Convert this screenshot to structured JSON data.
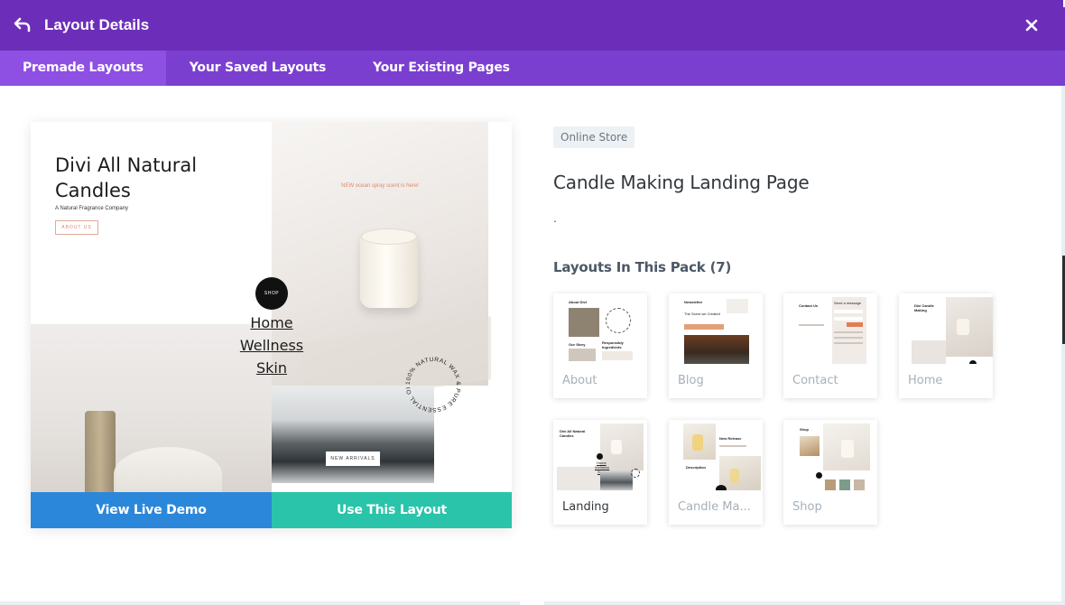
{
  "header": {
    "title": "Layout Details",
    "back_icon": "undo-arrow-icon",
    "close_icon": "close-icon",
    "color": "#6c2eb9"
  },
  "tabs": [
    {
      "label": "Premade Layouts",
      "active": true
    },
    {
      "label": "Your Saved Layouts",
      "active": false
    },
    {
      "label": "Your Existing Pages",
      "active": false
    }
  ],
  "preview": {
    "title": "Divi All Natural Candles",
    "subtitle": "A Natural Fragrance Company",
    "about_button": "ABOUT US",
    "announcement": "NEW ocean spray scent is here!",
    "shop_button": "SHOP",
    "links": [
      "Home",
      "Wellness",
      "Skin"
    ],
    "badge_text": "100% NATURAL WAX & PURE ESSENTIAL OILS •",
    "arrivals_button": "NEW ARRIVALS"
  },
  "actions": {
    "demo_label": "View Live Demo",
    "use_label": "Use This Layout",
    "demo_color": "#2b87da",
    "use_color": "#29c4a9"
  },
  "details": {
    "category": "Online Store",
    "title": "Candle Making Landing Page",
    "description": ".",
    "pack_heading": "Layouts In This Pack (7)"
  },
  "pack": [
    {
      "label": "About",
      "active": false,
      "thumb_text": [
        "About Divi",
        "Our Story",
        "Responsibly Ingredients"
      ]
    },
    {
      "label": "Blog",
      "active": false,
      "thumb_text": [
        "Newsletter",
        "The Scent we Created"
      ]
    },
    {
      "label": "Contact",
      "active": false,
      "thumb_text": [
        "Contact Us",
        "Send a message"
      ]
    },
    {
      "label": "Home",
      "active": false,
      "thumb_text": [
        "Divi Candle Making"
      ]
    },
    {
      "label": "Landing",
      "active": true,
      "thumb_text": [
        "Divi All Natural Candles",
        "Home",
        "Wellness",
        "Skin"
      ]
    },
    {
      "label": "Candle Ma...",
      "active": false,
      "thumb_text": [
        "New Release",
        "Description"
      ]
    },
    {
      "label": "Shop",
      "active": false,
      "thumb_text": [
        "Shop"
      ]
    }
  ]
}
